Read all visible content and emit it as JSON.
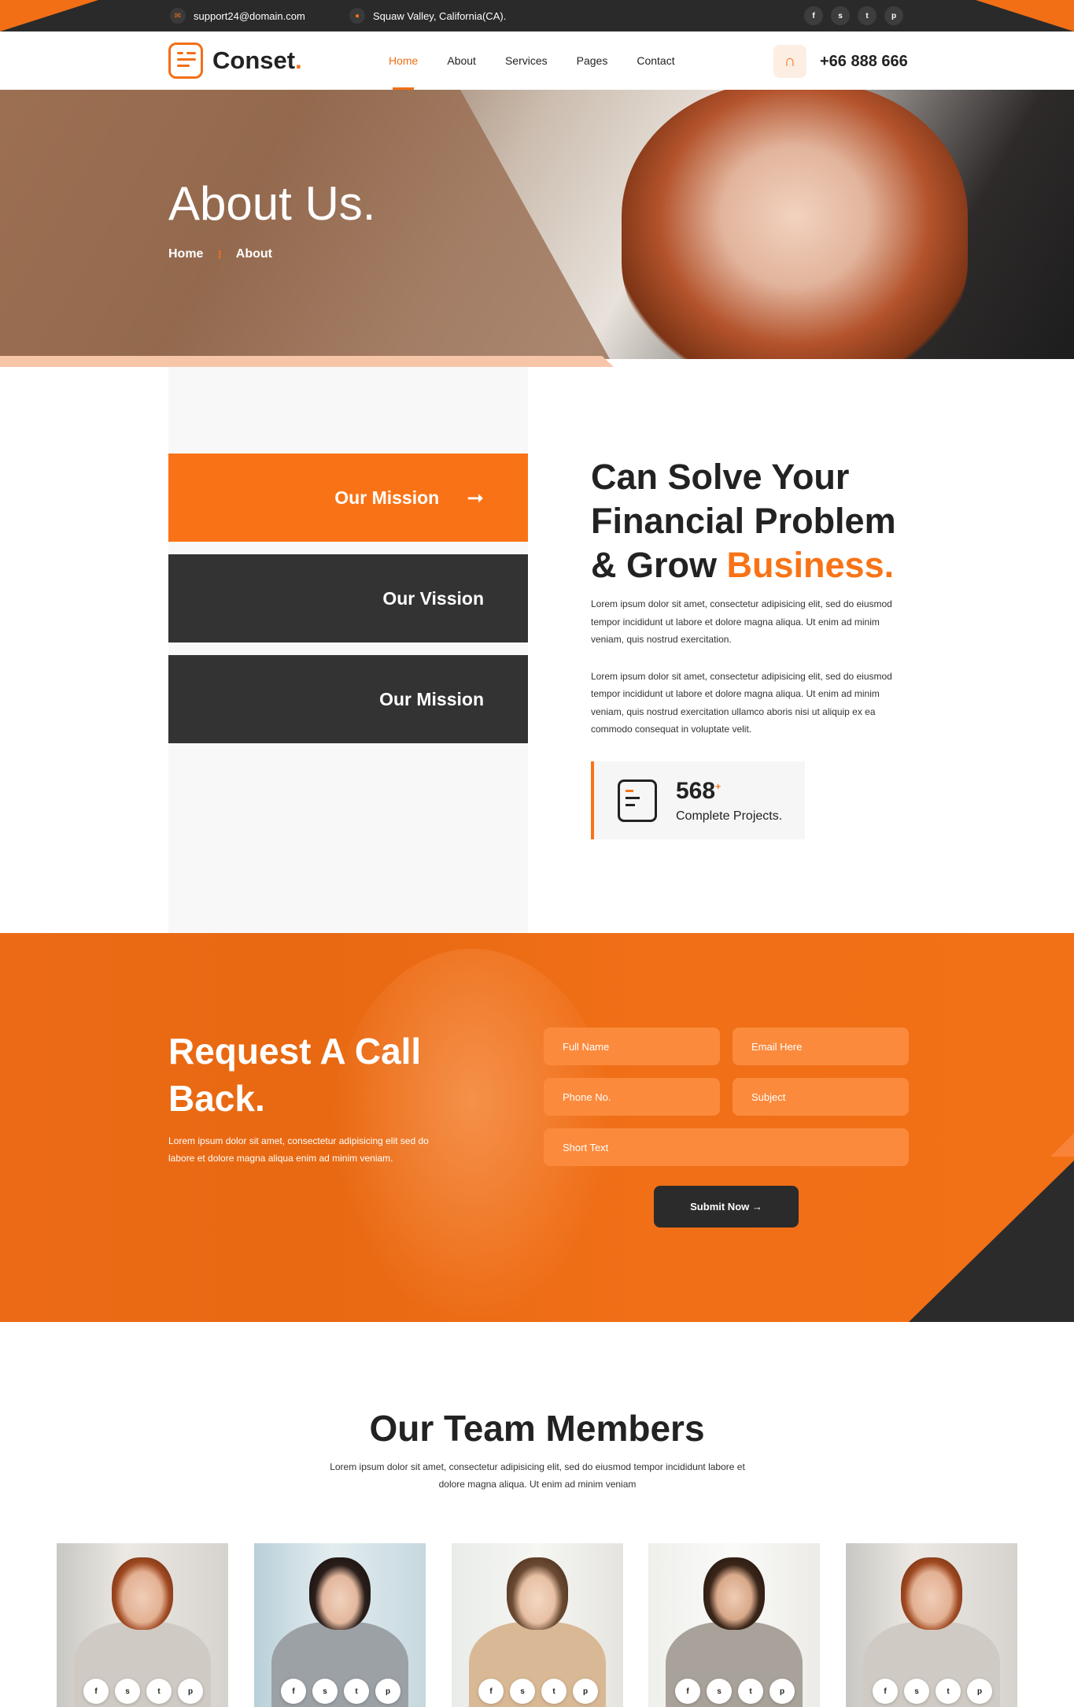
{
  "topbar": {
    "email": "support24@domain.com",
    "location": "Squaw Valley, California(CA).",
    "socials": [
      "f",
      "s",
      "t",
      "p"
    ]
  },
  "header": {
    "logo_text": "Conset",
    "logo_dot": ".",
    "nav": [
      "Home",
      "About",
      "Services",
      "Pages",
      "Contact"
    ],
    "phone": "+66 888 666"
  },
  "hero": {
    "title": "About Us.",
    "breadcrumb_home": "Home",
    "breadcrumb_sep": "⁝",
    "breadcrumb_current": "About"
  },
  "about": {
    "tabs": [
      "Our Mission",
      "Our Vission",
      "Our Mission"
    ],
    "heading_line1": "Can Solve Your",
    "heading_line2": "Financial Problem",
    "heading_line3_pre": "& Grow ",
    "heading_line3_hl": "Business.",
    "para1": "Lorem ipsum dolor sit amet, consectetur adipisicing elit, sed do eiusmod tempor incididunt ut labore et dolore magna aliqua. Ut enim ad minim veniam, quis nostrud exercitation.",
    "para2": "Lorem ipsum dolor sit amet, consectetur adipisicing elit, sed do eiusmod tempor incididunt ut labore et dolore magna aliqua. Ut enim ad minim veniam, quis nostrud exercitation ullamco aboris nisi ut aliquip ex ea commodo consequat in voluptate velit.",
    "stat_number": "568",
    "stat_sup": "+",
    "stat_label": "Complete Projects."
  },
  "callback": {
    "title": "Request A Call Back.",
    "desc": "Lorem ipsum dolor sit amet, consectetur adipisicing elit sed do labore et dolore magna aliqua enim ad minim veniam.",
    "fields": {
      "full_name": "Full Name",
      "email": "Email Here",
      "phone": "Phone No.",
      "subject": "Subject",
      "short_text": "Short Text"
    },
    "submit": "Submit Now →"
  },
  "team": {
    "title": "Our Team Members",
    "desc": "Lorem ipsum dolor sit amet, consectetur adipisicing elit, sed do eiusmod tempor incididunt labore et dolore magna aliqua. Ut enim ad minim veniam",
    "social_glyphs": [
      "f",
      "s",
      "t",
      "p"
    ]
  },
  "colors": {
    "accent": "#f97316",
    "dark": "#2b2b2b"
  }
}
